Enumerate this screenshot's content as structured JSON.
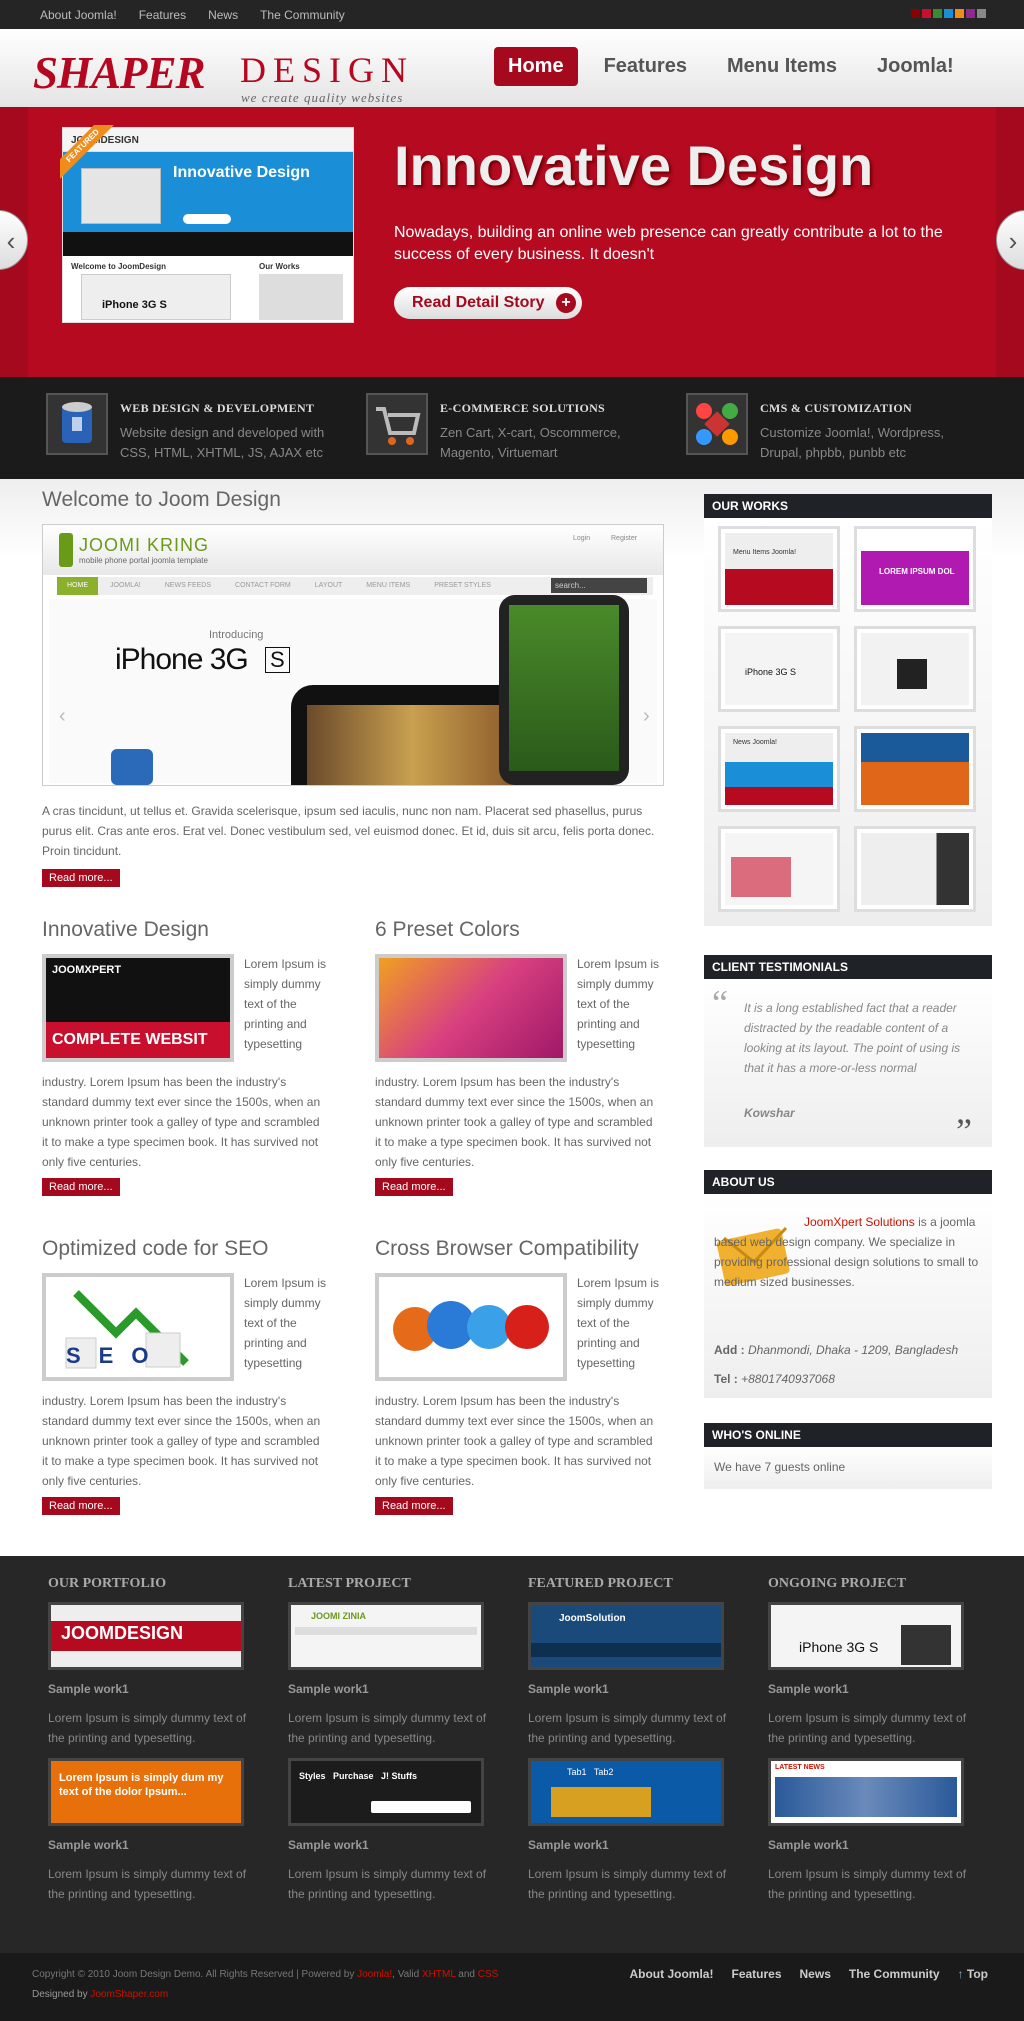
{
  "topbar": {
    "links": [
      "About Joomla!",
      "Features",
      "News",
      "The Community"
    ],
    "swatches": [
      "#8b0000",
      "#c8102e",
      "#3c8a2e",
      "#1a8fd8",
      "#f08c1a",
      "#8e2a8e",
      "#888888"
    ]
  },
  "header": {
    "logo_part1": "SHAPER",
    "logo_part2": "DESIGN",
    "tagline": "we create quality websites",
    "nav": [
      "Home",
      "Features",
      "Menu Items",
      "Joomla!"
    ]
  },
  "hero": {
    "title": "Innovative Design",
    "text": "Nowadays, building an online web presence can greatly contribute a lot to the success of every business. It doesn't",
    "button": "Read Detail Story",
    "ribbon": "FEATURED",
    "shot_title": "Innovative Design",
    "shot_logo": "JOOMDESIGN",
    "shot_welcome": "Welcome to JoomDesign",
    "shot_works": "Our Works",
    "shot_iphone": "iPhone 3G S"
  },
  "services": [
    {
      "title": "WEB DESIGN & DEVELOPMENT",
      "desc": "Website design and developed with CSS, HTML, XHTML, JS, AJAX etc",
      "icon": "paint-bucket-icon"
    },
    {
      "title": "E-COMMERCE SOLUTIONS",
      "desc": "Zen Cart, X-cart, Oscommerce, Magento, Virtuemart",
      "icon": "shopping-cart-icon"
    },
    {
      "title": "CMS & CUSTOMIZATION",
      "desc": "Customize Joomla!, Wordpress, Drupal, phpbb, punbb etc",
      "icon": "joomla-logo-icon"
    }
  ],
  "welcome": {
    "title": "Welcome to Joom Design",
    "shot_logo": "JOOMI KRING",
    "shot_sub": "mobile phone portal joomla template",
    "shot_introducing": "Introducing",
    "shot_product": "iPhone 3G",
    "shot_badge": "S",
    "shot_search": "search...",
    "shot_nav": [
      "HOME",
      "JOOMLA!",
      "NEWS FEEDS",
      "CONTACT FORM",
      "LAYOUT",
      "MENU ITEMS",
      "PRESET STYLES"
    ],
    "shot_login": "Login",
    "shot_register": "Register",
    "text": "A cras tincidunt, ut tellus et. Gravida scelerisque, ipsum sed iaculis, nunc non nam. Placerat sed phasellus, purus purus elit. Cras ante eros. Erat vel. Donec vestibulum sed, vel euismod donec. Et id, duis sit arcu, felis porta donec. Proin tincidunt.",
    "readmore": "Read more..."
  },
  "articles": [
    {
      "title": "Innovative Design",
      "side": "Lorem Ipsum is simply dummy text of the printing and typesetting",
      "body": "industry. Lorem Ipsum has been the industry's standard dummy text ever since the 1500s, when an unknown printer took a galley of type and scrambled it to make a type specimen book. It has survived not only five centuries.",
      "readmore": "Read more...",
      "thumb_text": "COMPLETE WEBSIT",
      "thumb_logo": "JOOMXPERT"
    },
    {
      "title": "6 Preset Colors",
      "side": "Lorem Ipsum is simply dummy text of the printing and typesetting",
      "body": "industry. Lorem Ipsum has been the industry's standard dummy text ever since the 1500s, when an unknown printer took a galley of type and scrambled it to make a type specimen book. It has survived not only five centuries.",
      "readmore": "Read more..."
    },
    {
      "title": "Optimized code for SEO",
      "side": "Lorem Ipsum is simply dummy text of the printing and typesetting",
      "body": "industry. Lorem Ipsum has been the industry's standard dummy text ever since the 1500s, when an unknown printer took a galley of type and scrambled it to make a type specimen book. It has survived not only five centuries.",
      "readmore": "Read more...",
      "thumb_text": "SEO"
    },
    {
      "title": "Cross Browser Compatibility",
      "side": "Lorem Ipsum is simply dummy text of the printing and typesetting",
      "body": "industry. Lorem Ipsum has been the industry's standard dummy text ever since the 1500s, when an unknown printer took a galley of type and scrambled it to make a type specimen book. It has survived not only five centuries.",
      "readmore": "Read more..."
    }
  ],
  "sidebar": {
    "works_title": "OUR WORKS",
    "works": [
      "Menu Items  Joomla!",
      "LOREM IPSUM DOL",
      "iPhone 3G S",
      "",
      "News  Joomla!",
      "",
      "",
      " "
    ],
    "testimonials_title": "CLIENT TESTIMONIALS",
    "testimonial": "It is a long established fact that a reader distracted by the readable content of a looking at its layout. The point of using is that it has a more-or-less normal",
    "testimonial_author": "Kowshar",
    "about_title": "ABOUT US",
    "about_company": "JoomXpert Solutions",
    "about_text": "is a joomla based web design company. We specialize in providing professional design solutions to small to medium sized businesses.",
    "add_label": "Add :",
    "add_value": "Dhanmondi, Dhaka - 1209, Bangladesh",
    "tel_label": "Tel :",
    "tel_value": "+8801740937068",
    "online_title": "WHO'S ONLINE",
    "online_text": "We have 7 guests online"
  },
  "footer": {
    "columns": [
      {
        "title": "OUR PORTFOLIO",
        "items": [
          {
            "name": "Sample work1",
            "desc": "Lorem Ipsum is simply dummy text of the printing and typesetting.",
            "thumb": "JOOMDESIGN"
          },
          {
            "name": "Sample work1",
            "desc": "Lorem Ipsum is simply dummy text of the printing and typesetting.",
            "thumb": "Lorem Ipsum is simply dum my text of the dolor Ipsum..."
          }
        ]
      },
      {
        "title": "LATEST PROJECT",
        "items": [
          {
            "name": "Sample work1",
            "desc": "Lorem Ipsum is simply dummy text of the printing and typesetting.",
            "thumb": "JOOMI ZINIA"
          },
          {
            "name": "Sample work1",
            "desc": "Lorem Ipsum is simply dummy text of the printing and typesetting.",
            "thumb": "Styles   Purchase   J! Stuffs"
          }
        ]
      },
      {
        "title": "FEATURED PROJECT",
        "items": [
          {
            "name": "Sample work1",
            "desc": "Lorem Ipsum is simply dummy text of the printing and typesetting.",
            "thumb": "JoomSolution"
          },
          {
            "name": "Sample work1",
            "desc": "Lorem Ipsum is simply dummy text of the printing and typesetting.",
            "thumb": "Tab1   Tab2"
          }
        ]
      },
      {
        "title": "ONGOING PROJECT",
        "items": [
          {
            "name": "Sample work1",
            "desc": "Lorem Ipsum is simply dummy text of the printing and typesetting.",
            "thumb": "iPhone 3G S"
          },
          {
            "name": "Sample work1",
            "desc": "Lorem Ipsum is simply dummy text of the printing and typesetting.",
            "thumb": "LATEST NEWS"
          }
        ]
      }
    ],
    "copyright": "Copyright © 2010 Joom Design Demo. All Rights Reserved | Powered by",
    "joomla": "Joomla!",
    "valid": ", Valid",
    "xhtml": "XHTML",
    "and": "and",
    "css": "CSS",
    "designed_by": "Designed by",
    "shaper": "JoomShaper.com",
    "links": [
      "About Joomla!",
      "Features",
      "News",
      "The Community",
      "Top"
    ]
  }
}
